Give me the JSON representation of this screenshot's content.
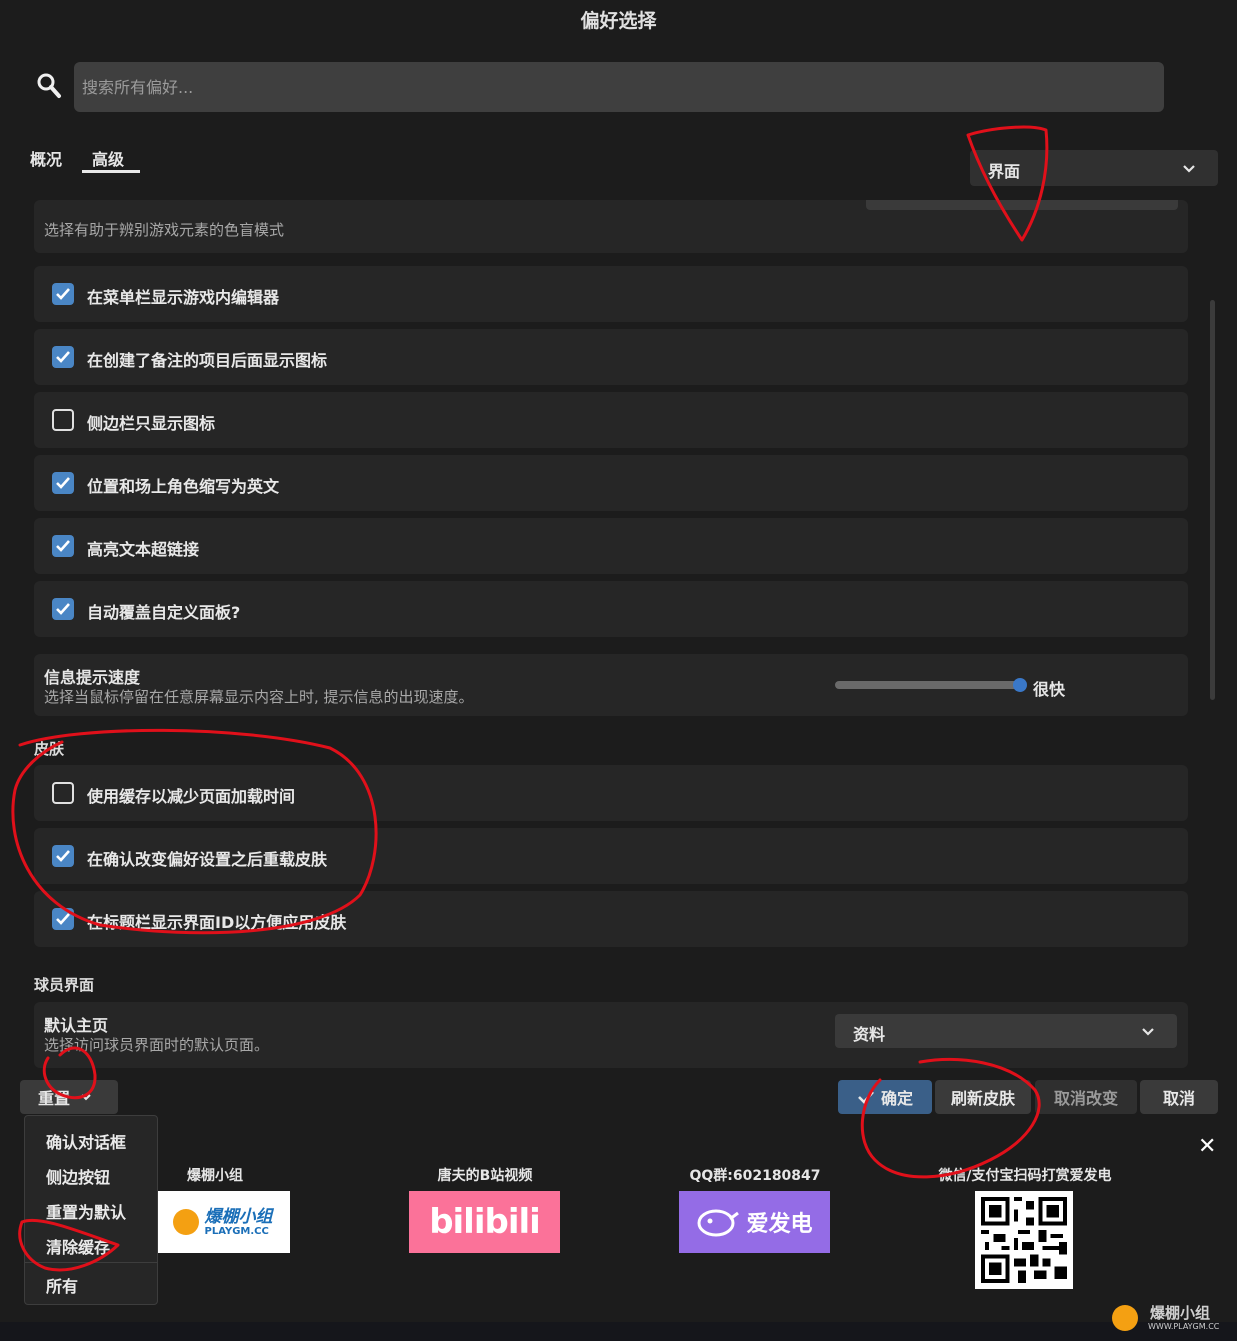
{
  "window_title": "偏好选择",
  "search": {
    "placeholder": "搜索所有偏好..."
  },
  "tabs": [
    {
      "label": "概况"
    },
    {
      "label": "高级"
    }
  ],
  "category_select": {
    "value": "界面"
  },
  "colorblind_desc": "选择有助于辨别游戏元素的色盲模式",
  "options": [
    {
      "label": "在菜单栏显示游戏内编辑器",
      "checked": true
    },
    {
      "label": "在创建了备注的项目后面显示图标",
      "checked": true
    },
    {
      "label": "侧边栏只显示图标",
      "checked": false
    },
    {
      "label": "位置和场上角色缩写为英文",
      "checked": true
    },
    {
      "label": "高亮文本超链接",
      "checked": true
    },
    {
      "label": "自动覆盖自定义面板?",
      "checked": true
    }
  ],
  "tooltip_speed": {
    "title": "信息提示速度",
    "desc": "选择当鼠标停留在任意屏幕显示内容上时, 提示信息的出现速度。",
    "value_label": "很快",
    "level": 1.0
  },
  "skin_section": {
    "title": "皮肤",
    "options": [
      {
        "label": "使用缓存以减少页面加载时间",
        "checked": false
      },
      {
        "label": "在确认改变偏好设置之后重载皮肤",
        "checked": true
      },
      {
        "label": "在标题栏显示界面ID以方便应用皮肤",
        "checked": true
      }
    ]
  },
  "player_section": {
    "title": "球员界面",
    "default_home": {
      "title": "默认主页",
      "desc": "选择访问球员界面时的默认页面。",
      "value": "资料"
    }
  },
  "buttons": {
    "reset": "重置",
    "confirm": "确定",
    "refresh_skin": "刷新皮肤",
    "cancel_changes": "取消改变",
    "cancel": "取消"
  },
  "reset_menu": [
    "确认对话框",
    "侧边按钮",
    "重置为默认",
    "清除缓存",
    "所有"
  ],
  "footer": {
    "group_label": "爆棚小组",
    "group_logo_text": "爆棚小组",
    "group_logo_sub": "PLAYGM.CC",
    "bili_label": "唐夫的B站视频",
    "bili_logo_text": "bilibili",
    "qq_label": "QQ群:602180847",
    "afdian_text": "爱发电",
    "pay_label": "微信/支付宝扫码打赏爱发电"
  },
  "watermark": {
    "text": "爆棚小组",
    "url": "WWW.PLAYGM.CC"
  },
  "colors": {
    "accent": "#4a86c5",
    "bili_pink": "#fb7299",
    "afdian_purple": "#946ce6",
    "annotation_red": "#e0101a"
  }
}
